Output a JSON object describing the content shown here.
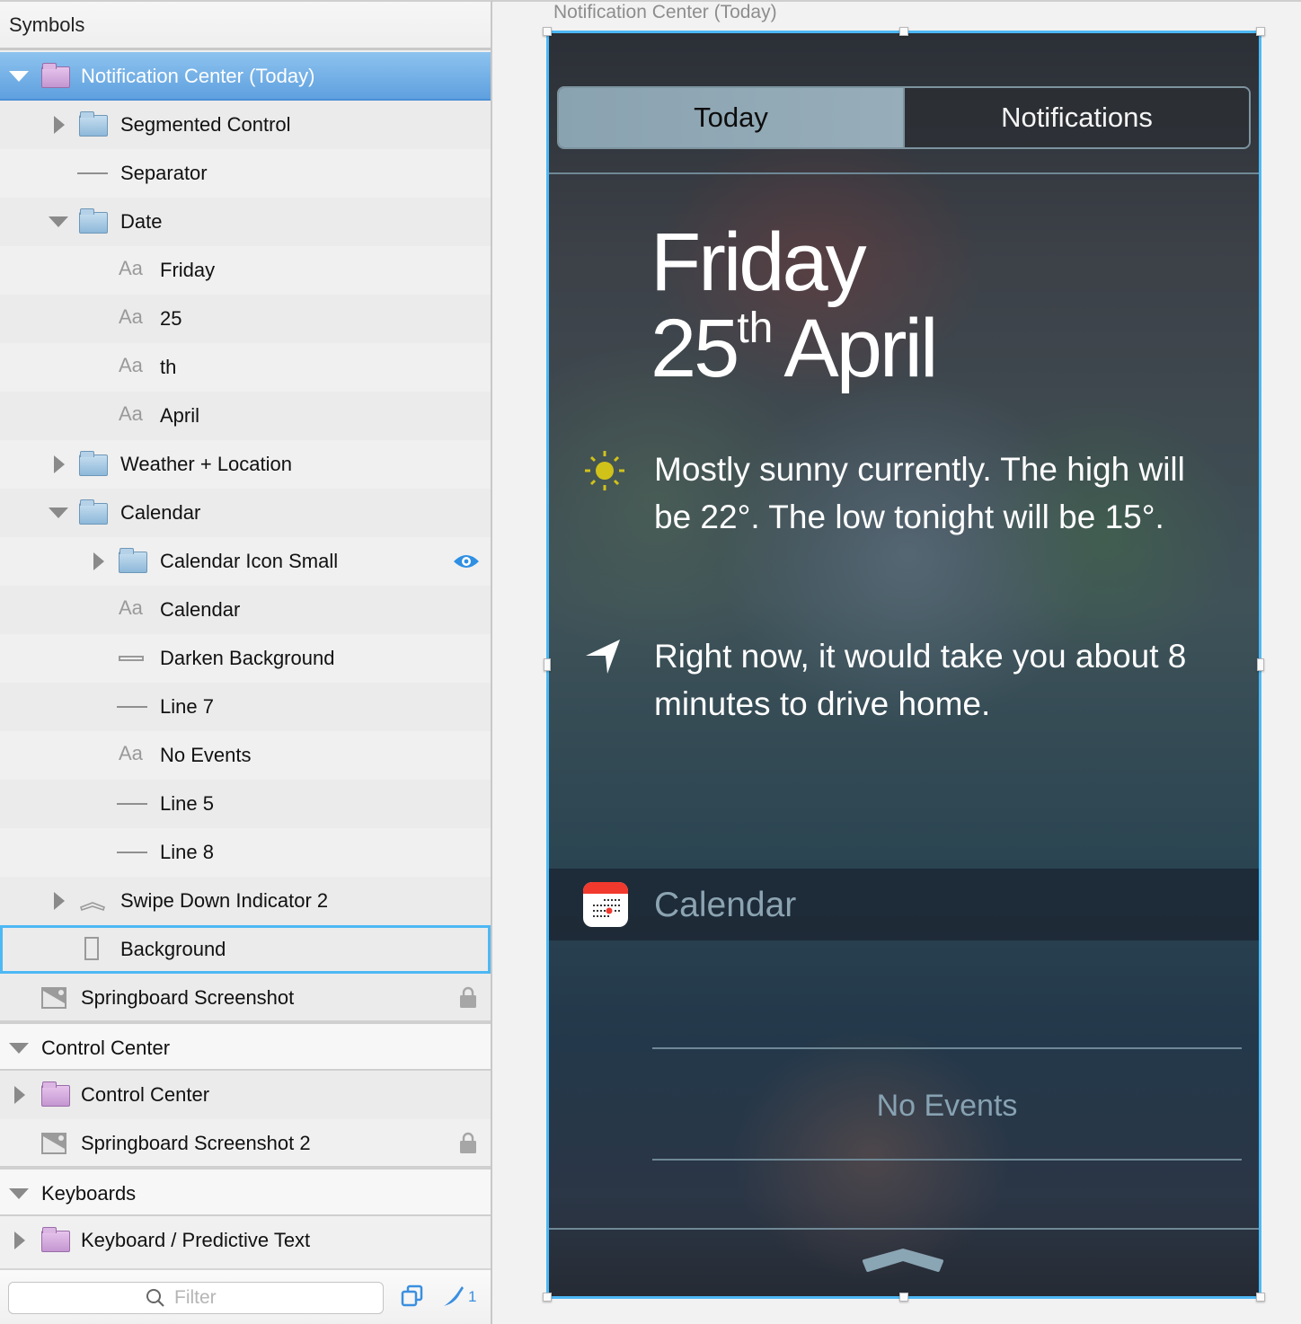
{
  "sidebar": {
    "header": "Symbols",
    "rows": [
      {
        "label": "Notification Center (Today)",
        "icon": "folder-purple-icon",
        "disclosure": "down",
        "state": "selected"
      },
      {
        "label": "Segmented Control",
        "icon": "folder-icon",
        "disclosure": "right"
      },
      {
        "label": "Separator",
        "icon": "line-icon",
        "disclosure": "none"
      },
      {
        "label": "Date",
        "icon": "folder-icon",
        "disclosure": "down"
      },
      {
        "label": "Friday",
        "icon": "text-layer-icon",
        "icon_text": "Aa"
      },
      {
        "label": "25",
        "icon": "text-layer-icon",
        "icon_text": "Aa"
      },
      {
        "label": "th",
        "icon": "text-layer-icon",
        "icon_text": "Aa"
      },
      {
        "label": "April",
        "icon": "text-layer-icon",
        "icon_text": "Aa"
      },
      {
        "label": "Weather + Location",
        "icon": "folder-icon",
        "disclosure": "right"
      },
      {
        "label": "Calendar",
        "icon": "folder-icon",
        "disclosure": "down"
      },
      {
        "label": "Calendar Icon Small",
        "icon": "folder-icon",
        "disclosure": "right",
        "badge": "eye-icon"
      },
      {
        "label": "Calendar",
        "icon": "text-layer-icon",
        "icon_text": "Aa"
      },
      {
        "label": "Darken Background",
        "icon": "rectangle-icon"
      },
      {
        "label": "Line 7",
        "icon": "line-icon"
      },
      {
        "label": "No Events",
        "icon": "text-layer-icon",
        "icon_text": "Aa"
      },
      {
        "label": "Line 5",
        "icon": "line-icon"
      },
      {
        "label": "Line 8",
        "icon": "line-icon"
      },
      {
        "label": "Swipe Down Indicator 2",
        "icon": "chevron-shape-icon",
        "disclosure": "right"
      },
      {
        "label": "Background",
        "icon": "rectangle-outline-icon",
        "state": "highlighted"
      },
      {
        "label": "Springboard Screenshot",
        "icon": "image-icon",
        "badge": "lock-icon"
      },
      {
        "label": "Control Center",
        "type": "group",
        "disclosure": "down"
      },
      {
        "label": "Control Center",
        "icon": "folder-purple-icon",
        "disclosure": "right"
      },
      {
        "label": "Springboard Screenshot 2",
        "icon": "image-icon",
        "badge": "lock-icon"
      },
      {
        "label": "Keyboards",
        "type": "group",
        "disclosure": "down"
      },
      {
        "label": "Keyboard / Predictive Text",
        "icon": "folder-purple-icon",
        "disclosure": "right"
      }
    ],
    "footer": {
      "filter_placeholder": "Filter",
      "filter_value": "",
      "slice_count": "1"
    }
  },
  "canvas": {
    "artboard_title": "Notification Center (Today)",
    "segmented": {
      "active": "Today",
      "inactive": "Notifications"
    },
    "date": {
      "day": "Friday",
      "number": "25",
      "suffix": "th",
      "month": "April"
    },
    "weather_text": "Mostly sunny currently. The high will be 22°. The low tonight will be 15°.",
    "traffic_text": "Right now, it would take you about 8 minutes to drive home.",
    "calendar_title": "Calendar",
    "no_events": "No Events"
  },
  "colors": {
    "selection_blue": "#4db8f4",
    "selected_row": "#6aa8e2",
    "sun_yellow": "#d1c21a",
    "calendar_red": "#f2392e",
    "accent_blue": "#3a8fe0"
  }
}
